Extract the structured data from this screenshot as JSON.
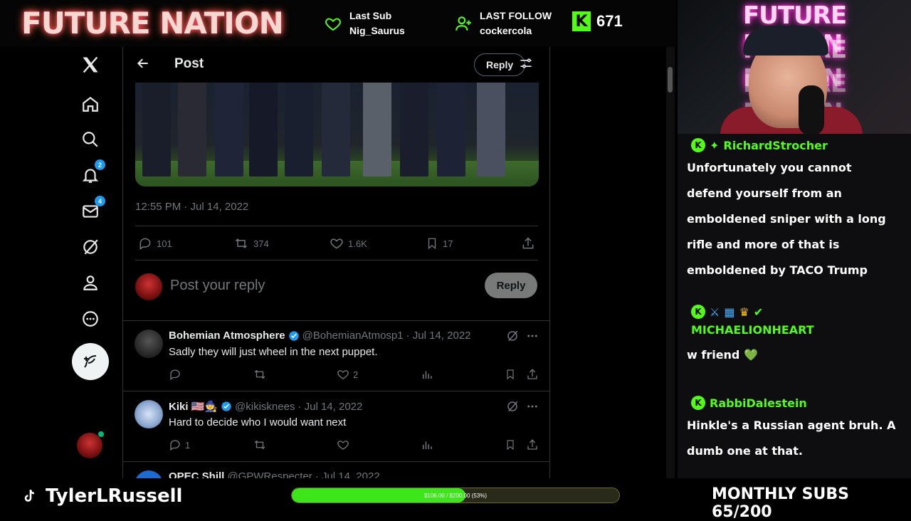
{
  "overlay": {
    "brand": "FUTURE NATION",
    "last_sub_label": "Last Sub",
    "last_sub_name": "Nig_Saurus",
    "last_follow_label": "LAST FOLLOW",
    "last_follow_name": "cockercola",
    "kick_badge": "K",
    "kick_count": "671",
    "streamer": "TylerLRussell",
    "progress_text": "$106.00 / $200.00 (53%)",
    "progress_fraction": 0.53,
    "monthly_subs": "MONTHLY SUBS 65/200"
  },
  "twitter": {
    "nav": {
      "notifications_badge": "2",
      "messages_badge": "4"
    },
    "header": {
      "title": "Post",
      "reply_label": "Reply"
    },
    "post": {
      "timestamp": "12:55 PM · Jul 14, 2022",
      "replies": "101",
      "reposts": "374",
      "likes": "1.6K",
      "bookmarks": "17"
    },
    "composer": {
      "placeholder": "Post your reply",
      "button": "Reply"
    },
    "replies": [
      {
        "name": "Bohemian Atmosphere",
        "handle": "@BohemianAtmosp1",
        "date": "· Jul 14, 2022",
        "text": "Sadly they will just wheel in the next puppet.",
        "reply_count": "",
        "like_count": "2"
      },
      {
        "name": "Kiki 🇺🇸🧙",
        "handle": "@kikisknees",
        "date": "· Jul 14, 2022",
        "text": "Hard to decide who I would want next",
        "reply_count": "1",
        "like_count": ""
      },
      {
        "name": "OPEC Shill",
        "handle": "@GPWRespecter",
        "date": "· Jul 14, 2022",
        "text": "",
        "reply_count": "",
        "like_count": ""
      }
    ]
  },
  "chat": {
    "messages": [
      {
        "user": "RichardStrocher",
        "text": "Unfortunately you cannot defend yourself from an emboldened sniper with a long rifle and more of that is emboldened by TACO Trump"
      },
      {
        "user": "MICHAELIONHEART",
        "text": "w friend 💚"
      },
      {
        "user": "RabbiDalestein",
        "text": "Hinkle's a Russian agent bruh. A dumb one at that."
      }
    ]
  },
  "colors": {
    "kick_green": "#53fc18",
    "twitter_blue": "#1d9bf0",
    "muted": "#71767b"
  }
}
